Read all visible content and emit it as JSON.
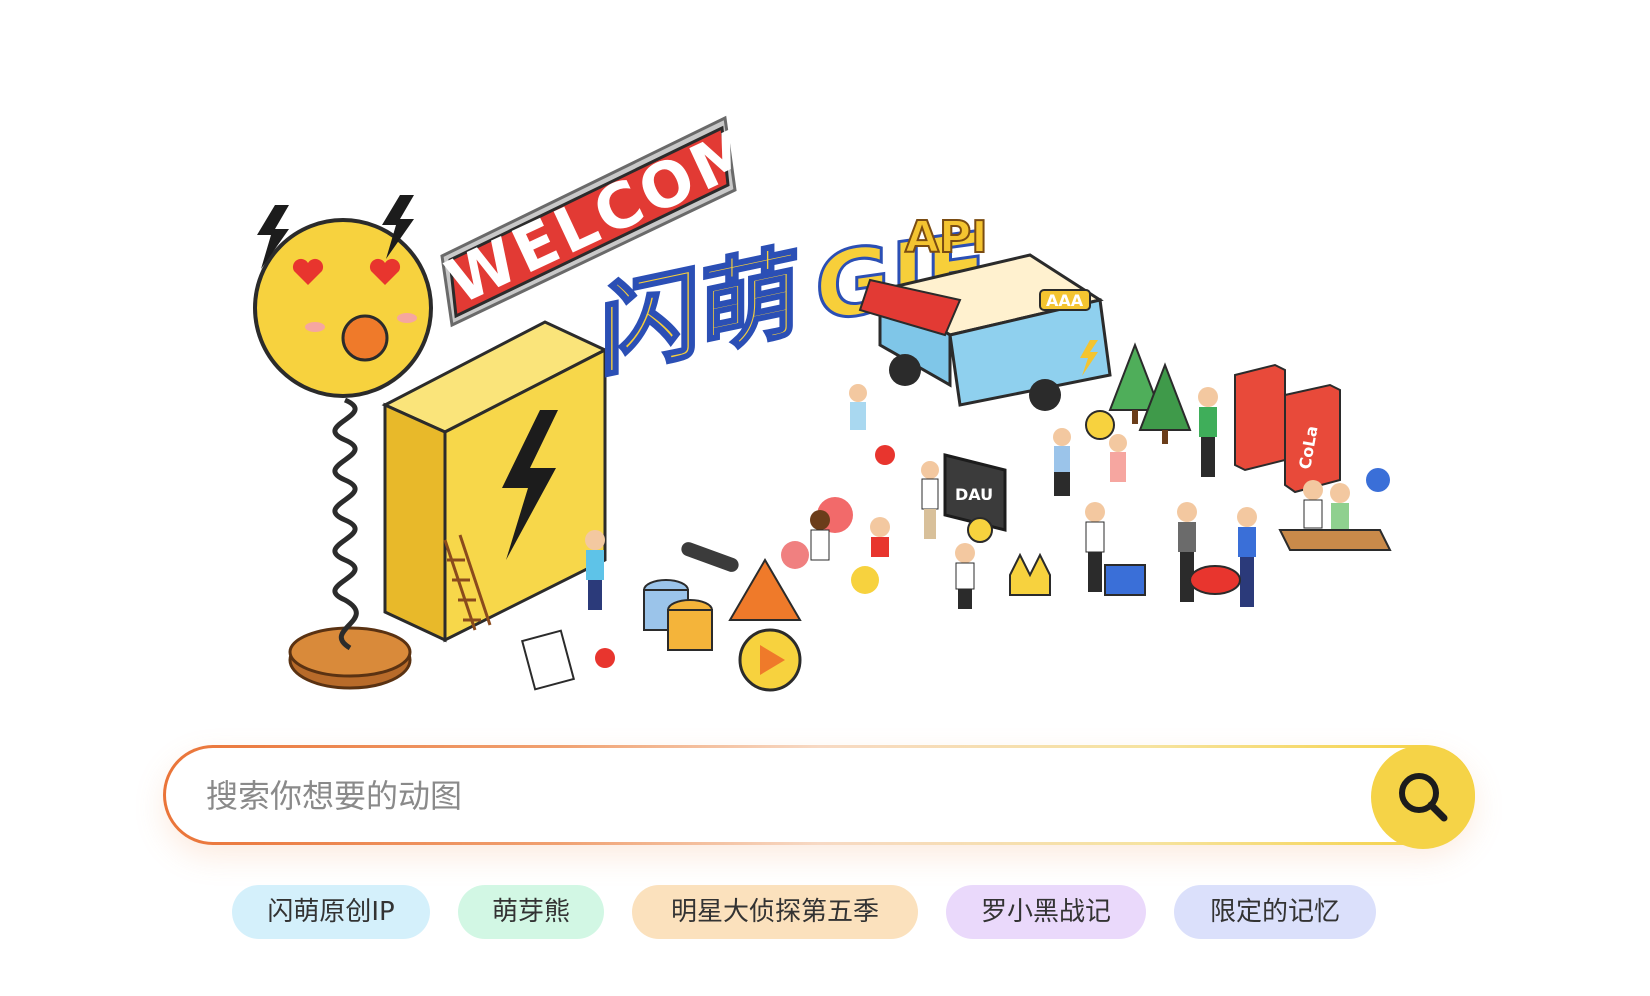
{
  "hero": {
    "welcome_sign": "WELCOME",
    "logo_cn": "闪萌",
    "logo_en": "GIF",
    "van_sign": "API",
    "van_plate": "AAA",
    "board_label": "DAU",
    "vending_label": "CoLa"
  },
  "search": {
    "placeholder": "搜索你想要的动图",
    "value": "",
    "button_icon": "search-icon"
  },
  "tags": [
    {
      "label": "闪萌原创IP",
      "color": "#d4f0fb"
    },
    {
      "label": "萌芽熊",
      "color": "#d2f7e4"
    },
    {
      "label": "明星大侦探第五季",
      "color": "#fbe1bd"
    },
    {
      "label": "罗小黑战记",
      "color": "#ead9fb"
    },
    {
      "label": "限定的记忆",
      "color": "#dbe0fb"
    }
  ],
  "colors": {
    "accent_yellow": "#f5d347",
    "gradient_start": "#ea7438",
    "gradient_end": "#f5cf3a"
  }
}
